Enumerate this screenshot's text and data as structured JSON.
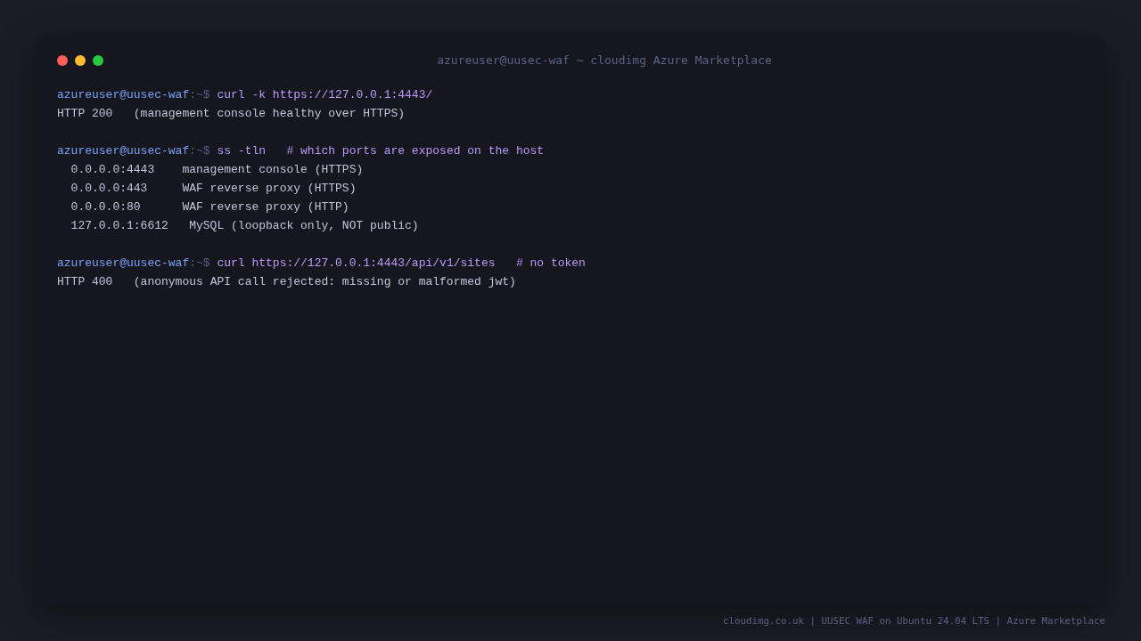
{
  "window": {
    "title": "azureuser@uusec-waf ~ cloudimg Azure Marketplace"
  },
  "sessions": [
    {
      "prompt": "azureuser@uusec-waf",
      "cwd": ":~$",
      "command": "curl -k https://127.0.0.1:4443/",
      "output": [
        {
          "kind": "text",
          "text": "HTTP 200   (management console healthy over HTTPS)"
        }
      ]
    },
    {
      "prompt": "azureuser@uusec-waf",
      "cwd": ":~$",
      "command": "ss -tln   # which ports are exposed on the host",
      "output": [
        {
          "kind": "socket",
          "text": "0.0.0.0:4443    management console (HTTPS)"
        },
        {
          "kind": "socket",
          "text": "0.0.0.0:443     WAF reverse proxy (HTTPS)"
        },
        {
          "kind": "socket",
          "text": "0.0.0.0:80      WAF reverse proxy (HTTP)"
        },
        {
          "kind": "socket",
          "text": "127.0.0.1:6612   MySQL (loopback only, NOT public)"
        }
      ]
    },
    {
      "prompt": "azureuser@uusec-waf",
      "cwd": ":~$",
      "command": "curl https://127.0.0.1:4443/api/v1/sites   # no token",
      "output": [
        {
          "kind": "text",
          "text": "HTTP 400   (anonymous API call rejected: missing or malformed jwt)"
        }
      ]
    }
  ],
  "footer": "cloudimg.co.uk | UUSEC WAF on Ubuntu 24.04 LTS | Azure Marketplace"
}
